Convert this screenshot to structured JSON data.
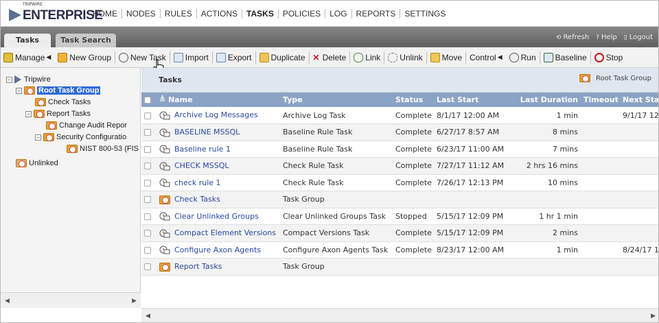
{
  "logo": {
    "small": "TRIPWIRE",
    "big": "ENTERPRISE"
  },
  "nav": [
    "HOME",
    "NODES",
    "RULES",
    "ACTIONS",
    "TASKS",
    "POLICIES",
    "LOG",
    "REPORTS",
    "SETTINGS"
  ],
  "nav_active": "TASKS",
  "tabs": {
    "tasks": "Tasks",
    "search": "Task Search"
  },
  "toplinks": {
    "refresh": "Refresh",
    "help": "Help",
    "logout": "Logout"
  },
  "toolbar": {
    "manage": "Manage",
    "new_group": "New Group",
    "new_task": "New Task",
    "import": "Import",
    "export": "Export",
    "duplicate": "Duplicate",
    "delete": "Delete",
    "link": "Link",
    "unlink": "Unlink",
    "move": "Move",
    "control": "Control",
    "run": "Run",
    "baseline": "Baseline",
    "stop": "Stop"
  },
  "tree": {
    "root": "Tripwire",
    "root_group": "Root Task Group",
    "check_tasks": "Check Tasks",
    "report_tasks": "Report Tasks",
    "change_audit": "Change Audit Repor",
    "security_config": "Security Configuratio",
    "nist": "NIST 800-53 (FIS",
    "unlinked": "Unlinked"
  },
  "panel": {
    "title": "Tasks",
    "breadcrumb": "Root Task Group"
  },
  "columns": [
    "Name",
    "Type",
    "Status",
    "Last Start",
    "Last Duration",
    "Timeout",
    "Next Star"
  ],
  "rows": [
    {
      "name": "Archive Log Messages",
      "type": "Archive Log Task",
      "status": "Complete",
      "last_start": "8/1/17 12:00 AM",
      "duration": "1 min",
      "timeout": "",
      "next": "9/1/17 12",
      "icon": "task-icon"
    },
    {
      "name": "BASELINE MSSQL",
      "type": "Baseline Rule Task",
      "status": "Complete",
      "last_start": "6/27/17 8:57 AM",
      "duration": "8 mins",
      "timeout": "",
      "next": "",
      "icon": "task-icon"
    },
    {
      "name": "Baseline rule 1",
      "type": "Baseline Rule Task",
      "status": "Complete",
      "last_start": "6/23/17 11:00 AM",
      "duration": "7 mins",
      "timeout": "",
      "next": "",
      "icon": "task-icon"
    },
    {
      "name": "CHECK MSSQL",
      "type": "Check Rule Task",
      "status": "Complete",
      "last_start": "7/27/17 11:12 AM",
      "duration": "2 hrs 16 mins",
      "timeout": "",
      "next": "",
      "icon": "task-icon"
    },
    {
      "name": "check rule 1",
      "type": "Check Rule Task",
      "status": "Complete",
      "last_start": "7/26/17 12:13 PM",
      "duration": "10 mins",
      "timeout": "",
      "next": "",
      "icon": "task-icon"
    },
    {
      "name": "Check Tasks",
      "type": "Task Group",
      "status": "",
      "last_start": "",
      "duration": "",
      "timeout": "",
      "next": "",
      "icon": "group-icon"
    },
    {
      "name": "Clear Unlinked Groups",
      "type": "Clear Unlinked Groups Task",
      "status": "Stopped",
      "last_start": "5/15/17 12:09 PM",
      "duration": "1 hr 1 min",
      "timeout": "",
      "next": "",
      "icon": "task-icon"
    },
    {
      "name": "Compact Element Versions",
      "type": "Compact Versions Task",
      "status": "Complete",
      "last_start": "5/15/17 12:09 PM",
      "duration": "2 mins",
      "timeout": "",
      "next": "",
      "icon": "task-icon"
    },
    {
      "name": "Configure Axon Agents",
      "type": "Configure Axon Agents Task",
      "status": "Complete",
      "last_start": "8/23/17 12:00 AM",
      "duration": "1 min",
      "timeout": "",
      "next": "8/24/17 1",
      "icon": "task-icon"
    },
    {
      "name": "Report Tasks",
      "type": "Task Group",
      "status": "",
      "last_start": "",
      "duration": "",
      "timeout": "",
      "next": "",
      "icon": "group-icon"
    }
  ]
}
